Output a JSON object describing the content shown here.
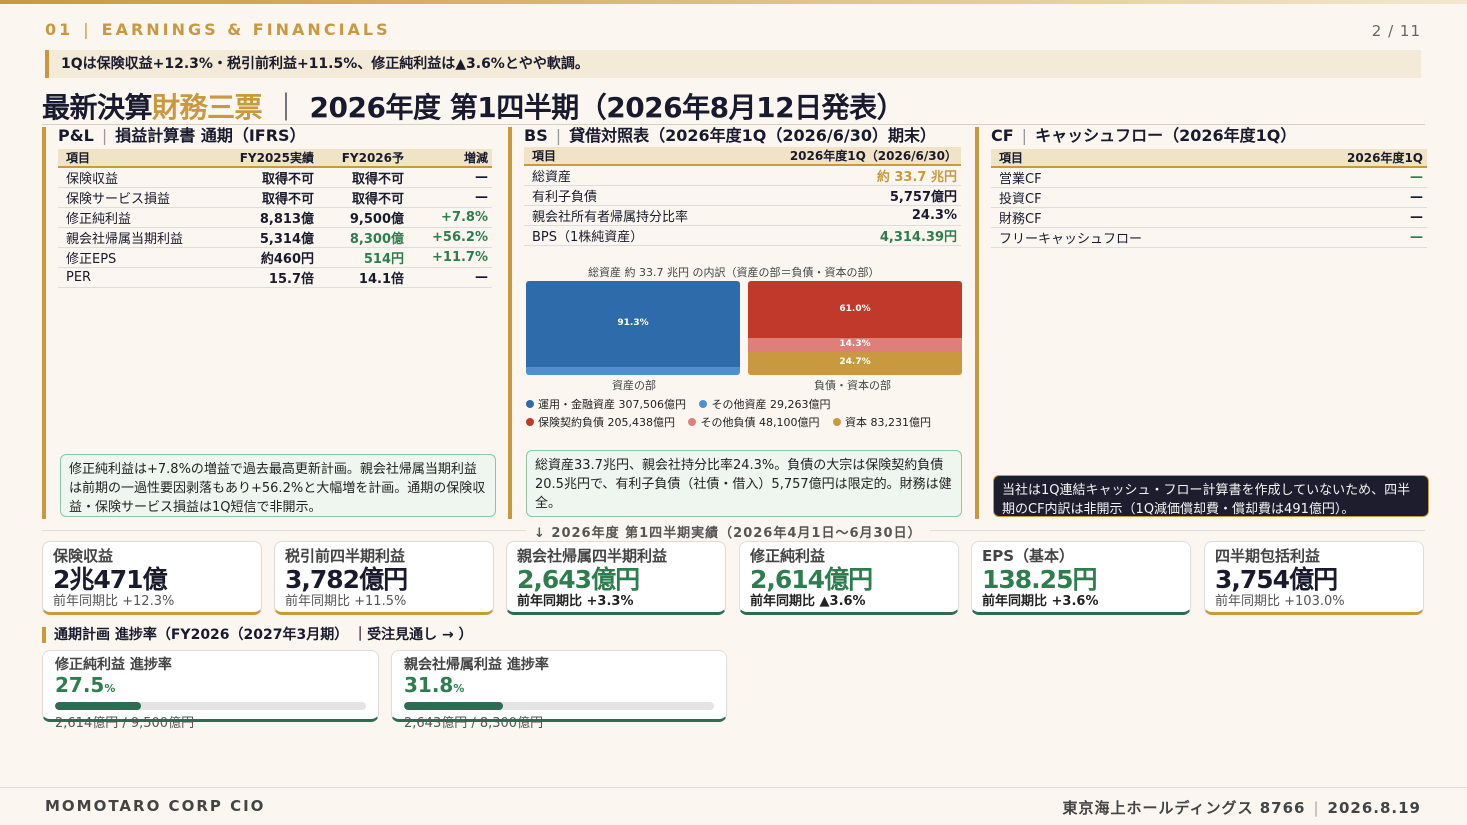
{
  "header": {
    "section_no": "01",
    "section_title": "EARNINGS & FINANCIALS",
    "page": "2 / 11"
  },
  "summary": "1Qは保険収益+12.3%・税引前利益+11.5%、修正純利益は▲3.6%とやや軟調。",
  "title": {
    "pre": "最新決算",
    "accent": "財務三票",
    "post": "2026年度 第1四半期（2026年8月12日発表）"
  },
  "pl": {
    "code": "P&L",
    "name": "損益計算書 通期（IFRS）",
    "columns": [
      "項目",
      "FY2025実績",
      "FY2026予",
      "増減"
    ],
    "rows": [
      {
        "item": "保険収益",
        "fy25": "取得不可",
        "fy26": "取得不可",
        "chg": "—"
      },
      {
        "item": "保険サービス損益",
        "fy25": "取得不可",
        "fy26": "取得不可",
        "chg": "—"
      },
      {
        "item": "修正純利益",
        "fy25": "8,813億",
        "fy26": "9,500億",
        "chg": "+7.8%"
      },
      {
        "item": "親会社帰属当期利益",
        "fy25": "5,314億",
        "fy26": "8,300億",
        "chg": "+56.2%"
      },
      {
        "item": "修正EPS",
        "fy25": "約460円",
        "fy26": "514円",
        "chg": "+11.7%"
      },
      {
        "item": "PER",
        "fy25": "15.7倍",
        "fy26": "14.1倍",
        "chg": "—"
      }
    ],
    "note": "修正純利益は+7.8%の増益で過去最高更新計画。親会社帰属当期利益は前期の一過性要因剥落もあり+56.2%と大幅増を計画。通期の保険収益・保険サービス損益は1Q短信で非開示。"
  },
  "bs": {
    "code": "BS",
    "name": "貸借対照表（2026年度1Q（2026/6/30）期末）",
    "columns": [
      "項目",
      "2026年度1Q（2026/6/30）"
    ],
    "rows": [
      {
        "item": "総資産",
        "val": "約 33.7 兆円"
      },
      {
        "item": "有利子負債",
        "val": "5,757億円"
      },
      {
        "item": "親会社所有者帰属持分比率",
        "val": "24.3%"
      },
      {
        "item": "BPS（1株純資産）",
        "val": "4,314.39円"
      }
    ],
    "note": "総資産33.7兆円、親会社持分比率24.3%。負債の大宗は保険契約負債20.5兆円で、有利子負債（社債・借入）5,757億円は限定的。財務は健全。"
  },
  "chart_data": {
    "type": "bar",
    "title": "総資産 約 33.7 兆円 の内訳（資産の部＝負債・資本の部）",
    "categories": [
      "資産の部",
      "負債・資本の部"
    ],
    "series": [
      {
        "name": "運用・金融資産 307,506億円",
        "stack": "資産の部",
        "values": [
          307506
        ],
        "label": "91.3%",
        "color": "#2e6bab"
      },
      {
        "name": "その他資産 29,263億円",
        "stack": "資産の部",
        "values": [
          29263
        ],
        "label": "",
        "color": "#4d8fd0"
      },
      {
        "name": "保険契約負債 205,438億円",
        "stack": "負債・資本の部",
        "values": [
          205438
        ],
        "label": "61.0%",
        "color": "#c0392b"
      },
      {
        "name": "その他負債 48,100億円",
        "stack": "負債・資本の部",
        "values": [
          48100
        ],
        "label": "14.3%",
        "color": "#de8079"
      },
      {
        "name": "資本 83,231億円",
        "stack": "負債・資本の部",
        "values": [
          83231
        ],
        "label": "24.7%",
        "color": "#c9993f"
      }
    ]
  },
  "cf": {
    "code": "CF",
    "name": "キャッシュフロー（2026年度1Q）",
    "columns": [
      "項目",
      "2026年度1Q"
    ],
    "rows": [
      {
        "item": "営業CF",
        "val": "—"
      },
      {
        "item": "投資CF",
        "val": "—"
      },
      {
        "item": "財務CF",
        "val": "—"
      },
      {
        "item": "フリーキャッシュフロー",
        "val": "—"
      }
    ],
    "note": "当社は1Q連結キャッシュ・フロー計算書を作成していないため、四半期のCF内訳は非開示（1Q減価償却費・償却費は491億円）。"
  },
  "divider_label": "↓ 2026年度 第1四半期実績（2026年4月1日〜6月30日）",
  "kpis": [
    {
      "label": "保険収益",
      "value": "2兆471億",
      "sub": "前年同期比 +12.3%"
    },
    {
      "label": "税引前四半期利益",
      "value": "3,782億円",
      "sub": "前年同期比 +11.5%"
    },
    {
      "label": "親会社帰属四半期利益",
      "value": "2,643億円",
      "sub": "前年同期比 +3.3%"
    },
    {
      "label": "修正純利益",
      "value": "2,614億円",
      "sub": "前年同期比 ▲3.6%"
    },
    {
      "label": "EPS（基本）",
      "value": "138.25円",
      "sub": "前年同期比 +3.6%"
    },
    {
      "label": "四半期包括利益",
      "value": "3,754億円",
      "sub": "前年同期比 +103.0%"
    }
  ],
  "progress_heading": "通期計画 進捗率（FY2026（2027年3月期） ｜受注見通し → ）",
  "progress": [
    {
      "label": "修正純利益 進捗率",
      "value": "27.5",
      "unit": "%",
      "pct": 27.5,
      "detail": "2,614億円 / 9,500億円"
    },
    {
      "label": "親会社帰属利益 進捗率",
      "value": "31.8",
      "unit": "%",
      "pct": 31.8,
      "detail": "2,643億円 / 8,300億円"
    }
  ],
  "footer": {
    "left": "MOMOTARO CORP CIO",
    "company": "東京海上ホールディングス 8766",
    "date": "2026.8.19"
  }
}
